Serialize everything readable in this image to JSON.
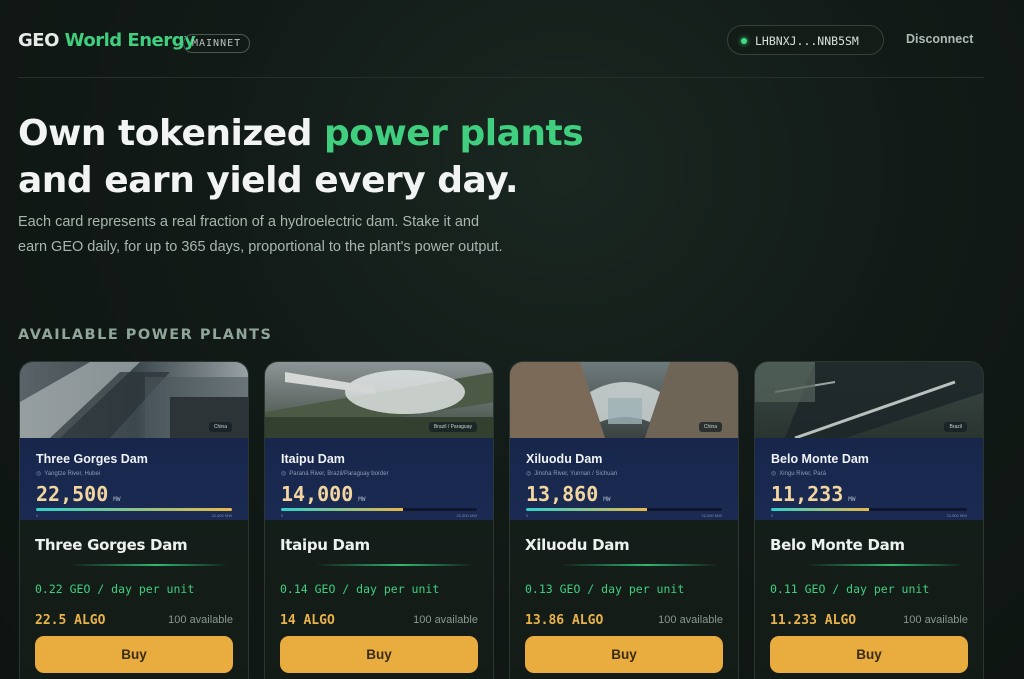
{
  "header": {
    "logo_prefix": "GEO",
    "logo_name": "World Energy",
    "network": "MAINNET",
    "wallet_address": "LHBNXJ...NNB5SM",
    "disconnect": "Disconnect"
  },
  "hero": {
    "title_1": "Own tokenized ",
    "title_highlight": "power plants",
    "title_2": " and earn yield every day.",
    "description": "Each card represents a real fraction of a hydroelectric dam. Stake it and earn GEO daily, for up to 365 days, proportional to the plant's power output."
  },
  "section_title": "AVAILABLE POWER PLANTS",
  "cards": [
    {
      "photo_tag": "China",
      "name": "Three Gorges Dam",
      "location": "Yangtze River, Hubei",
      "capacity": "22,500",
      "unit": "MW",
      "capacity_fraction": 1.0,
      "scale_min": "0",
      "scale_max": "22,500 MW",
      "title": "Three Gorges Dam",
      "yield": "0.22 GEO / day per unit",
      "price": "22.5 ALGO",
      "available": "100 available",
      "buy_label": "Buy"
    },
    {
      "photo_tag": "Brazil / Paraguay",
      "name": "Itaipu Dam",
      "location": "Paraná River, Brazil/Paraguay border",
      "capacity": "14,000",
      "unit": "MW",
      "capacity_fraction": 0.62,
      "scale_min": "0",
      "scale_max": "22,500 MW",
      "title": "Itaipu Dam",
      "yield": "0.14 GEO / day per unit",
      "price": "14 ALGO",
      "available": "100 available",
      "buy_label": "Buy"
    },
    {
      "photo_tag": "China",
      "name": "Xiluodu Dam",
      "location": "Jinsha River, Yunnan / Sichuan",
      "capacity": "13,860",
      "unit": "MW",
      "capacity_fraction": 0.616,
      "scale_min": "0",
      "scale_max": "22,500 MW",
      "title": "Xiluodu Dam",
      "yield": "0.13 GEO / day per unit",
      "price": "13.86 ALGO",
      "available": "100 available",
      "buy_label": "Buy"
    },
    {
      "photo_tag": "Brazil",
      "name": "Belo Monte Dam",
      "location": "Xingu River, Pará",
      "capacity": "11,233",
      "unit": "MW",
      "capacity_fraction": 0.5,
      "scale_min": "0",
      "scale_max": "22,500 MW",
      "title": "Belo Monte Dam",
      "yield": "0.11 GEO / day per unit",
      "price": "11.233 ALGO",
      "available": "100 available",
      "buy_label": "Buy"
    }
  ]
}
